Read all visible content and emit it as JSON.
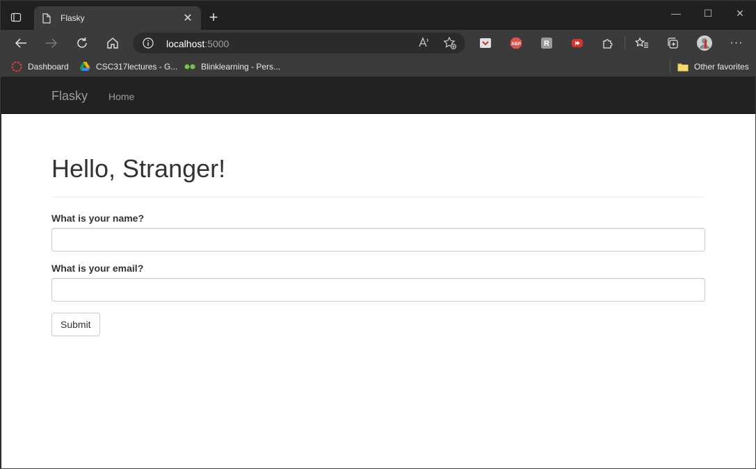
{
  "browser": {
    "tab": {
      "title": "Flasky",
      "close_glyph": "✕"
    },
    "new_tab_glyph": "+",
    "window_controls": {
      "minimize": "—",
      "maximize": "☐",
      "close": "✕"
    },
    "address": {
      "host": "localhost",
      "port": ":5000"
    },
    "read_aloud_glyph": "A",
    "more_glyph": "···",
    "extensions": [
      {
        "name": "pocket-extension-icon",
        "color": "#e0e0e0"
      },
      {
        "name": "adblock-plus-icon",
        "color": "#d9534f",
        "text": "ABP"
      },
      {
        "name": "extension-r-icon",
        "color": "#9a9a9a",
        "text": "R"
      },
      {
        "name": "video-extension-icon",
        "color": "#d9342b"
      }
    ],
    "bookmarks": [
      {
        "label": "Dashboard",
        "icon": "dashboard-ring-icon"
      },
      {
        "label": "CSC317lectures - G...",
        "icon": "google-drive-icon"
      },
      {
        "label": "Blinklearning - Pers...",
        "icon": "blinklearning-icon"
      }
    ],
    "other_favorites": "Other favorites"
  },
  "navbar": {
    "brand": "Flasky",
    "links": [
      "Home"
    ]
  },
  "page": {
    "heading": "Hello, Stranger!",
    "form": {
      "name_label": "What is your name?",
      "name_value": "",
      "email_label": "What is your email?",
      "email_value": "",
      "submit_label": "Submit"
    }
  },
  "colors": {
    "navbar_bg": "#222222",
    "navbar_text": "#9d9d9d",
    "chrome_bg": "#3b3b3b",
    "text": "#333333"
  }
}
